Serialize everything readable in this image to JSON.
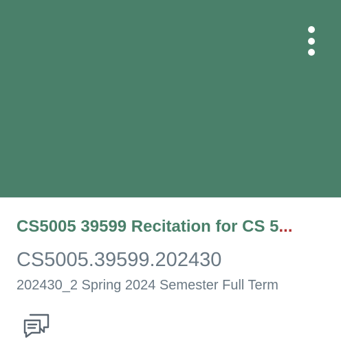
{
  "theme": {
    "accent": "#4a806a",
    "ellipsis_color": "#b03030",
    "text_muted": "#6a7883"
  },
  "card": {
    "title": "CS5005 39599 Recitation for CS 5",
    "title_ellipsis": "...",
    "course_code": "CS5005.39599.202430",
    "term": "202430_2 Spring 2024 Semester Full Term",
    "menu_icon": "more-vertical-icon",
    "action_icon": "discussions-icon"
  }
}
